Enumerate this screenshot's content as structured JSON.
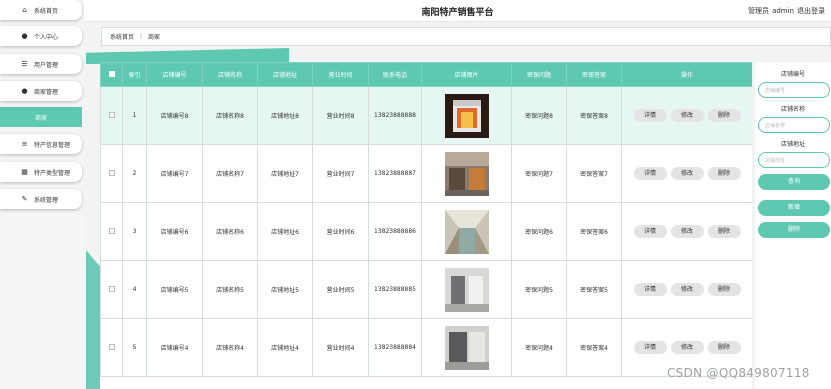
{
  "sidebar": {
    "items": [
      {
        "label": "系统首页",
        "icon": "home-icon",
        "glyph": "⌂"
      },
      {
        "label": "个人中心",
        "icon": "user-icon",
        "glyph": "●"
      },
      {
        "label": "用户管理",
        "icon": "sliders-icon",
        "glyph": "☰"
      },
      {
        "label": "商家管理",
        "icon": "user-icon",
        "glyph": "●"
      },
      {
        "label": "商家",
        "icon": "",
        "glyph": ""
      },
      {
        "label": "特产信息管理",
        "icon": "list-icon",
        "glyph": "≡"
      },
      {
        "label": "特产类型管理",
        "icon": "grid-icon",
        "glyph": "▦"
      },
      {
        "label": "系统管理",
        "icon": "settings-icon",
        "glyph": "✎"
      }
    ]
  },
  "header": {
    "title": "南阳特产销售平台",
    "user_role": "管理员",
    "username": "admin",
    "logout": "退出登录"
  },
  "breadcrumb": {
    "home": "系统首页",
    "sep": "⋮",
    "current": "商家"
  },
  "table": {
    "headers": [
      "索引",
      "店铺编号",
      "店铺名称",
      "店铺地址",
      "营业时间",
      "联系电话",
      "店铺图片",
      "密保问题",
      "密保答案",
      "操作"
    ],
    "rows": [
      {
        "idx": "1",
        "code": "店铺编号8",
        "name": "店铺名称8",
        "addr": "店铺地址8",
        "hours": "营业时间8",
        "phone": "13823888888",
        "q": "密保问题8",
        "a": "密保答案8"
      },
      {
        "idx": "2",
        "code": "店铺编号7",
        "name": "店铺名称7",
        "addr": "店铺地址7",
        "hours": "营业时间7",
        "phone": "13823888887",
        "q": "密保问题7",
        "a": "密保答案7"
      },
      {
        "idx": "3",
        "code": "店铺编号6",
        "name": "店铺名称6",
        "addr": "店铺地址6",
        "hours": "营业时间6",
        "phone": "13823888886",
        "q": "密保问题6",
        "a": "密保答案6"
      },
      {
        "idx": "4",
        "code": "店铺编号5",
        "name": "店铺名称5",
        "addr": "店铺地址5",
        "hours": "营业时间5",
        "phone": "13823888885",
        "q": "密保问题5",
        "a": "密保答案5"
      },
      {
        "idx": "5",
        "code": "店铺编号4",
        "name": "店铺名称4",
        "addr": "店铺地址4",
        "hours": "营业时间4",
        "phone": "13823888884",
        "q": "密保问题4",
        "a": "密保答案4"
      }
    ],
    "actions": {
      "detail": "详情",
      "edit": "修改",
      "delete": "删除"
    }
  },
  "search": {
    "code_label": "店铺编号",
    "code_placeholder": "店铺编号",
    "name_label": "店铺名称",
    "name_placeholder": "店铺名称",
    "addr_label": "店铺地址",
    "addr_placeholder": "店铺地址",
    "query": "查询",
    "add": "新增",
    "delete": "删除"
  },
  "watermark": "CSDN @QQ849807118",
  "colors": {
    "accent": "#5ec8b0",
    "selected_row": "#e6f6f2"
  }
}
